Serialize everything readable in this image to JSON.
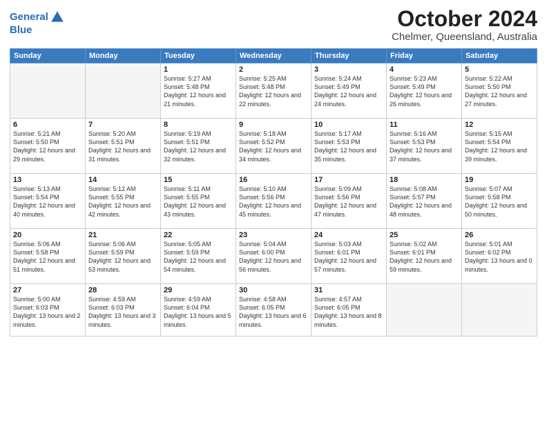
{
  "header": {
    "logo_line1": "General",
    "logo_line2": "Blue",
    "month": "October 2024",
    "location": "Chelmer, Queensland, Australia"
  },
  "weekdays": [
    "Sunday",
    "Monday",
    "Tuesday",
    "Wednesday",
    "Thursday",
    "Friday",
    "Saturday"
  ],
  "weeks": [
    [
      {
        "date": "",
        "sunrise": "",
        "sunset": "",
        "daylight": ""
      },
      {
        "date": "",
        "sunrise": "",
        "sunset": "",
        "daylight": ""
      },
      {
        "date": "1",
        "sunrise": "Sunrise: 5:27 AM",
        "sunset": "Sunset: 5:48 PM",
        "daylight": "Daylight: 12 hours and 21 minutes."
      },
      {
        "date": "2",
        "sunrise": "Sunrise: 5:25 AM",
        "sunset": "Sunset: 5:48 PM",
        "daylight": "Daylight: 12 hours and 22 minutes."
      },
      {
        "date": "3",
        "sunrise": "Sunrise: 5:24 AM",
        "sunset": "Sunset: 5:49 PM",
        "daylight": "Daylight: 12 hours and 24 minutes."
      },
      {
        "date": "4",
        "sunrise": "Sunrise: 5:23 AM",
        "sunset": "Sunset: 5:49 PM",
        "daylight": "Daylight: 12 hours and 26 minutes."
      },
      {
        "date": "5",
        "sunrise": "Sunrise: 5:22 AM",
        "sunset": "Sunset: 5:50 PM",
        "daylight": "Daylight: 12 hours and 27 minutes."
      }
    ],
    [
      {
        "date": "6",
        "sunrise": "Sunrise: 5:21 AM",
        "sunset": "Sunset: 5:50 PM",
        "daylight": "Daylight: 12 hours and 29 minutes."
      },
      {
        "date": "7",
        "sunrise": "Sunrise: 5:20 AM",
        "sunset": "Sunset: 5:51 PM",
        "daylight": "Daylight: 12 hours and 31 minutes."
      },
      {
        "date": "8",
        "sunrise": "Sunrise: 5:19 AM",
        "sunset": "Sunset: 5:51 PM",
        "daylight": "Daylight: 12 hours and 32 minutes."
      },
      {
        "date": "9",
        "sunrise": "Sunrise: 5:18 AM",
        "sunset": "Sunset: 5:52 PM",
        "daylight": "Daylight: 12 hours and 34 minutes."
      },
      {
        "date": "10",
        "sunrise": "Sunrise: 5:17 AM",
        "sunset": "Sunset: 5:53 PM",
        "daylight": "Daylight: 12 hours and 35 minutes."
      },
      {
        "date": "11",
        "sunrise": "Sunrise: 5:16 AM",
        "sunset": "Sunset: 5:53 PM",
        "daylight": "Daylight: 12 hours and 37 minutes."
      },
      {
        "date": "12",
        "sunrise": "Sunrise: 5:15 AM",
        "sunset": "Sunset: 5:54 PM",
        "daylight": "Daylight: 12 hours and 39 minutes."
      }
    ],
    [
      {
        "date": "13",
        "sunrise": "Sunrise: 5:13 AM",
        "sunset": "Sunset: 5:54 PM",
        "daylight": "Daylight: 12 hours and 40 minutes."
      },
      {
        "date": "14",
        "sunrise": "Sunrise: 5:12 AM",
        "sunset": "Sunset: 5:55 PM",
        "daylight": "Daylight: 12 hours and 42 minutes."
      },
      {
        "date": "15",
        "sunrise": "Sunrise: 5:11 AM",
        "sunset": "Sunset: 5:55 PM",
        "daylight": "Daylight: 12 hours and 43 minutes."
      },
      {
        "date": "16",
        "sunrise": "Sunrise: 5:10 AM",
        "sunset": "Sunset: 5:56 PM",
        "daylight": "Daylight: 12 hours and 45 minutes."
      },
      {
        "date": "17",
        "sunrise": "Sunrise: 5:09 AM",
        "sunset": "Sunset: 5:56 PM",
        "daylight": "Daylight: 12 hours and 47 minutes."
      },
      {
        "date": "18",
        "sunrise": "Sunrise: 5:08 AM",
        "sunset": "Sunset: 5:57 PM",
        "daylight": "Daylight: 12 hours and 48 minutes."
      },
      {
        "date": "19",
        "sunrise": "Sunrise: 5:07 AM",
        "sunset": "Sunset: 5:58 PM",
        "daylight": "Daylight: 12 hours and 50 minutes."
      }
    ],
    [
      {
        "date": "20",
        "sunrise": "Sunrise: 5:06 AM",
        "sunset": "Sunset: 5:58 PM",
        "daylight": "Daylight: 12 hours and 51 minutes."
      },
      {
        "date": "21",
        "sunrise": "Sunrise: 5:06 AM",
        "sunset": "Sunset: 5:59 PM",
        "daylight": "Daylight: 12 hours and 53 minutes."
      },
      {
        "date": "22",
        "sunrise": "Sunrise: 5:05 AM",
        "sunset": "Sunset: 5:59 PM",
        "daylight": "Daylight: 12 hours and 54 minutes."
      },
      {
        "date": "23",
        "sunrise": "Sunrise: 5:04 AM",
        "sunset": "Sunset: 6:00 PM",
        "daylight": "Daylight: 12 hours and 56 minutes."
      },
      {
        "date": "24",
        "sunrise": "Sunrise: 5:03 AM",
        "sunset": "Sunset: 6:01 PM",
        "daylight": "Daylight: 12 hours and 57 minutes."
      },
      {
        "date": "25",
        "sunrise": "Sunrise: 5:02 AM",
        "sunset": "Sunset: 6:01 PM",
        "daylight": "Daylight: 12 hours and 59 minutes."
      },
      {
        "date": "26",
        "sunrise": "Sunrise: 5:01 AM",
        "sunset": "Sunset: 6:02 PM",
        "daylight": "Daylight: 13 hours and 0 minutes."
      }
    ],
    [
      {
        "date": "27",
        "sunrise": "Sunrise: 5:00 AM",
        "sunset": "Sunset: 6:03 PM",
        "daylight": "Daylight: 13 hours and 2 minutes."
      },
      {
        "date": "28",
        "sunrise": "Sunrise: 4:59 AM",
        "sunset": "Sunset: 6:03 PM",
        "daylight": "Daylight: 13 hours and 3 minutes."
      },
      {
        "date": "29",
        "sunrise": "Sunrise: 4:59 AM",
        "sunset": "Sunset: 6:04 PM",
        "daylight": "Daylight: 13 hours and 5 minutes."
      },
      {
        "date": "30",
        "sunrise": "Sunrise: 4:58 AM",
        "sunset": "Sunset: 6:05 PM",
        "daylight": "Daylight: 13 hours and 6 minutes."
      },
      {
        "date": "31",
        "sunrise": "Sunrise: 4:57 AM",
        "sunset": "Sunset: 6:05 PM",
        "daylight": "Daylight: 13 hours and 8 minutes."
      },
      {
        "date": "",
        "sunrise": "",
        "sunset": "",
        "daylight": ""
      },
      {
        "date": "",
        "sunrise": "",
        "sunset": "",
        "daylight": ""
      }
    ]
  ]
}
